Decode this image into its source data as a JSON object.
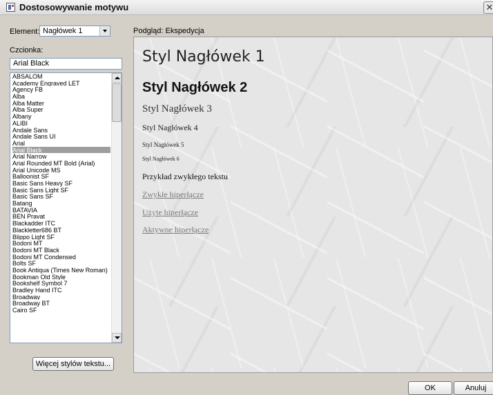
{
  "window": {
    "title": "Dostosowywanie motywu",
    "close_glyph": "✕"
  },
  "element": {
    "label": "Element:",
    "value": "Nagłówek 1"
  },
  "font": {
    "label": "Czcionka:",
    "value": "Arial Black",
    "selected": "Arial Black",
    "items": [
      "ABSALOM",
      "Academy Engraved LET",
      "Agency FB",
      "Alba",
      "Alba Matter",
      "Alba Super",
      "Albany",
      "ALIBI",
      "Andale Sans",
      "Andale Sans UI",
      "Arial",
      "Arial Black",
      "Arial Narrow",
      "Arial Rounded MT Bold (Arial)",
      "Arial Unicode MS",
      "Balloonist SF",
      "Basic Sans Heavy SF",
      "Basic Sans Light SF",
      "Basic Sans SF",
      "Batang",
      "BATAVIA",
      "BEN Pravat",
      "Blackadder ITC",
      "Blackletter686 BT",
      "Blippo Light SF",
      "Bodoni MT",
      "Bodoni MT Black",
      "Bodoni MT Condensed",
      "Bolts SF",
      "Book Antiqua (Times New Roman)",
      "Bookman Old Style",
      "Bookshelf Symbol 7",
      "Bradley Hand ITC",
      "Broadway",
      "Broadway BT",
      "Cairo SF"
    ]
  },
  "more_button": "Więcej stylów tekstu...",
  "preview": {
    "label": "Podgląd: Ekspedycja",
    "h1": "Styl Nagłówek 1",
    "h2": "Styl Nagłówek 2",
    "h3": "Styl Nagłówek 3",
    "h4": "Styl Nagłówek 4",
    "h5": "Styl Nagłówek 5",
    "h6": "Styl Nagłówek 6",
    "body": "Przykład zwykłego tekstu",
    "link_normal": "Zwykłe hiperłącze",
    "link_visited": "Użyte hiperłącze",
    "link_active": "Aktywne hiperłącze"
  },
  "buttons": {
    "ok": "OK",
    "cancel": "Anuluj"
  }
}
